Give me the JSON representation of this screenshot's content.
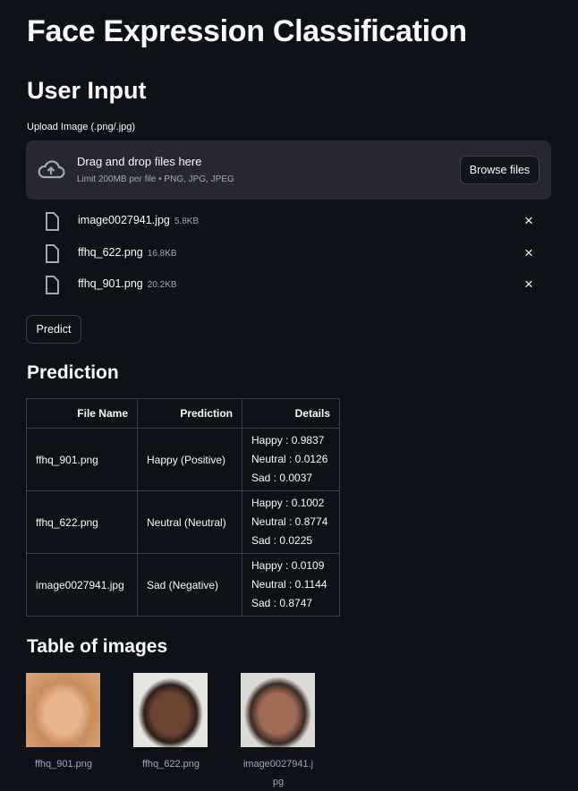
{
  "title": "Face Expression Classification",
  "user_input": {
    "heading": "User Input",
    "upload_label": "Upload Image (.png/.jpg)",
    "dropzone": {
      "title": "Drag and drop files here",
      "subtitle": "Limit 200MB per file • PNG, JPG, JPEG",
      "browse_label": "Browse files"
    },
    "files": [
      {
        "name": "image0027941.jpg",
        "size": "5.8KB"
      },
      {
        "name": "ffhq_622.png",
        "size": "16.8KB"
      },
      {
        "name": "ffhq_901.png",
        "size": "20.2KB"
      }
    ],
    "remove_icon": "×",
    "predict_label": "Predict"
  },
  "prediction": {
    "heading": "Prediction",
    "columns": [
      "File Name",
      "Prediction",
      "Details"
    ],
    "rows": [
      {
        "file": "ffhq_901.png",
        "prediction": "Happy (Positive)",
        "details": [
          "Happy : 0.9837",
          "Neutral : 0.0126",
          "Sad : 0.0037"
        ]
      },
      {
        "file": "ffhq_622.png",
        "prediction": "Neutral (Neutral)",
        "details": [
          "Happy : 0.1002",
          "Neutral : 0.8774",
          "Sad : 0.0225"
        ]
      },
      {
        "file": "image0027941.jpg",
        "prediction": "Sad (Negative)",
        "details": [
          "Happy : 0.0109",
          "Neutral : 0.1144",
          "Sad : 0.8747"
        ]
      }
    ]
  },
  "gallery": {
    "heading": "Table of images",
    "images": [
      {
        "caption": "ffhq_901.png"
      },
      {
        "caption": "ffhq_622.png"
      },
      {
        "caption": "image0027941.jpg"
      }
    ]
  }
}
